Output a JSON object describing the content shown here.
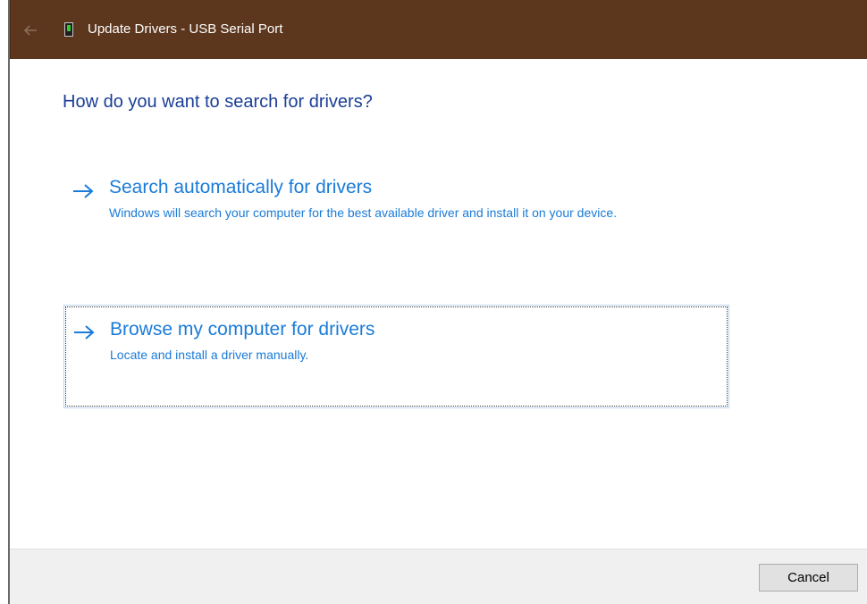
{
  "window": {
    "title": "Update Drivers - USB Serial Port",
    "back_icon": "back-arrow-icon",
    "app_icon": "device-icon"
  },
  "colors": {
    "titlebar": "#5c361d",
    "heading": "#1a3e96",
    "link": "#1a7bd8",
    "footer": "#f0f0f0"
  },
  "main": {
    "heading": "How do you want to search for drivers?",
    "options": [
      {
        "icon": "arrow-right-icon",
        "title": "Search automatically for drivers",
        "description": "Windows will search your computer for the best available driver and install it on your device."
      },
      {
        "icon": "arrow-right-icon",
        "title": "Browse my computer for drivers",
        "description": "Locate and install a driver manually."
      }
    ]
  },
  "footer": {
    "cancel_label": "Cancel"
  }
}
